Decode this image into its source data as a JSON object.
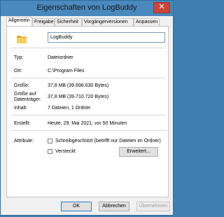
{
  "window": {
    "title": "Eigenschaften von LogBuddy",
    "close_label": "✕"
  },
  "tabs": [
    {
      "label": "Allgemein",
      "active": true
    },
    {
      "label": "Freigabe"
    },
    {
      "label": "Sicherheit"
    },
    {
      "label": "Vorgängerversionen"
    },
    {
      "label": "Anpassen"
    }
  ],
  "general": {
    "folder_icon": "folder-icon",
    "name_value": "LogBuddy",
    "type_label": "Typ:",
    "type_value": "Dateiordner",
    "location_label": "Ort:",
    "location_value": "C:\\Program Files",
    "size_label": "Größe:",
    "size_value": "37,8 MB (39.698.630 Bytes)",
    "disk_size_label_line1": "Größe auf",
    "disk_size_label_line2": "Datenträger:",
    "disk_size_value": "37,8 MB (39.710.720 Bytes)",
    "contents_label": "Inhalt:",
    "contents_value": "7 Dateien, 1 Ordner",
    "created_label": "Erstellt:",
    "created_value": "Heute, 29. Mai 2021, vor 50 Minuten",
    "attributes_label": "Attribute:",
    "readonly_label": "Schreibgeschützt (betrifft nur Dateien im Ordner)",
    "readonly_checked": false,
    "hidden_label": "Versteckt",
    "hidden_checked": false,
    "advanced_button": "Erweitert..."
  },
  "buttons": {
    "ok": "OK",
    "cancel": "Abbrechen",
    "apply": "Übernehmen"
  },
  "colors": {
    "accent": "#2c7bd6",
    "titlebar": "#4a89bd",
    "close": "#c7453b",
    "folder": "#e8c25a"
  }
}
